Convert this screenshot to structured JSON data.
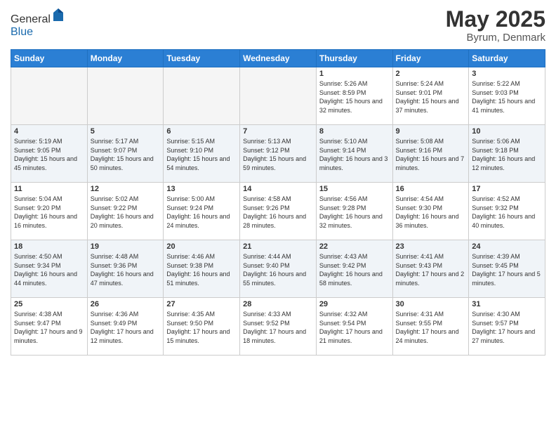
{
  "header": {
    "logo_general": "General",
    "logo_blue": "Blue",
    "month_title": "May 2025",
    "location": "Byrum, Denmark"
  },
  "days_of_week": [
    "Sunday",
    "Monday",
    "Tuesday",
    "Wednesday",
    "Thursday",
    "Friday",
    "Saturday"
  ],
  "weeks": [
    [
      {
        "num": "",
        "empty": true
      },
      {
        "num": "",
        "empty": true
      },
      {
        "num": "",
        "empty": true
      },
      {
        "num": "",
        "empty": true
      },
      {
        "num": "1",
        "sunrise": "5:26 AM",
        "sunset": "8:59 PM",
        "daylight": "15 hours and 32 minutes."
      },
      {
        "num": "2",
        "sunrise": "5:24 AM",
        "sunset": "9:01 PM",
        "daylight": "15 hours and 37 minutes."
      },
      {
        "num": "3",
        "sunrise": "5:22 AM",
        "sunset": "9:03 PM",
        "daylight": "15 hours and 41 minutes."
      }
    ],
    [
      {
        "num": "4",
        "sunrise": "5:19 AM",
        "sunset": "9:05 PM",
        "daylight": "15 hours and 45 minutes."
      },
      {
        "num": "5",
        "sunrise": "5:17 AM",
        "sunset": "9:07 PM",
        "daylight": "15 hours and 50 minutes."
      },
      {
        "num": "6",
        "sunrise": "5:15 AM",
        "sunset": "9:10 PM",
        "daylight": "15 hours and 54 minutes."
      },
      {
        "num": "7",
        "sunrise": "5:13 AM",
        "sunset": "9:12 PM",
        "daylight": "15 hours and 59 minutes."
      },
      {
        "num": "8",
        "sunrise": "5:10 AM",
        "sunset": "9:14 PM",
        "daylight": "16 hours and 3 minutes."
      },
      {
        "num": "9",
        "sunrise": "5:08 AM",
        "sunset": "9:16 PM",
        "daylight": "16 hours and 7 minutes."
      },
      {
        "num": "10",
        "sunrise": "5:06 AM",
        "sunset": "9:18 PM",
        "daylight": "16 hours and 12 minutes."
      }
    ],
    [
      {
        "num": "11",
        "sunrise": "5:04 AM",
        "sunset": "9:20 PM",
        "daylight": "16 hours and 16 minutes."
      },
      {
        "num": "12",
        "sunrise": "5:02 AM",
        "sunset": "9:22 PM",
        "daylight": "16 hours and 20 minutes."
      },
      {
        "num": "13",
        "sunrise": "5:00 AM",
        "sunset": "9:24 PM",
        "daylight": "16 hours and 24 minutes."
      },
      {
        "num": "14",
        "sunrise": "4:58 AM",
        "sunset": "9:26 PM",
        "daylight": "16 hours and 28 minutes."
      },
      {
        "num": "15",
        "sunrise": "4:56 AM",
        "sunset": "9:28 PM",
        "daylight": "16 hours and 32 minutes."
      },
      {
        "num": "16",
        "sunrise": "4:54 AM",
        "sunset": "9:30 PM",
        "daylight": "16 hours and 36 minutes."
      },
      {
        "num": "17",
        "sunrise": "4:52 AM",
        "sunset": "9:32 PM",
        "daylight": "16 hours and 40 minutes."
      }
    ],
    [
      {
        "num": "18",
        "sunrise": "4:50 AM",
        "sunset": "9:34 PM",
        "daylight": "16 hours and 44 minutes."
      },
      {
        "num": "19",
        "sunrise": "4:48 AM",
        "sunset": "9:36 PM",
        "daylight": "16 hours and 47 minutes."
      },
      {
        "num": "20",
        "sunrise": "4:46 AM",
        "sunset": "9:38 PM",
        "daylight": "16 hours and 51 minutes."
      },
      {
        "num": "21",
        "sunrise": "4:44 AM",
        "sunset": "9:40 PM",
        "daylight": "16 hours and 55 minutes."
      },
      {
        "num": "22",
        "sunrise": "4:43 AM",
        "sunset": "9:42 PM",
        "daylight": "16 hours and 58 minutes."
      },
      {
        "num": "23",
        "sunrise": "4:41 AM",
        "sunset": "9:43 PM",
        "daylight": "17 hours and 2 minutes."
      },
      {
        "num": "24",
        "sunrise": "4:39 AM",
        "sunset": "9:45 PM",
        "daylight": "17 hours and 5 minutes."
      }
    ],
    [
      {
        "num": "25",
        "sunrise": "4:38 AM",
        "sunset": "9:47 PM",
        "daylight": "17 hours and 9 minutes."
      },
      {
        "num": "26",
        "sunrise": "4:36 AM",
        "sunset": "9:49 PM",
        "daylight": "17 hours and 12 minutes."
      },
      {
        "num": "27",
        "sunrise": "4:35 AM",
        "sunset": "9:50 PM",
        "daylight": "17 hours and 15 minutes."
      },
      {
        "num": "28",
        "sunrise": "4:33 AM",
        "sunset": "9:52 PM",
        "daylight": "17 hours and 18 minutes."
      },
      {
        "num": "29",
        "sunrise": "4:32 AM",
        "sunset": "9:54 PM",
        "daylight": "17 hours and 21 minutes."
      },
      {
        "num": "30",
        "sunrise": "4:31 AM",
        "sunset": "9:55 PM",
        "daylight": "17 hours and 24 minutes."
      },
      {
        "num": "31",
        "sunrise": "4:30 AM",
        "sunset": "9:57 PM",
        "daylight": "17 hours and 27 minutes."
      }
    ]
  ],
  "labels": {
    "sunrise": "Sunrise:",
    "sunset": "Sunset:",
    "daylight": "Daylight:"
  }
}
